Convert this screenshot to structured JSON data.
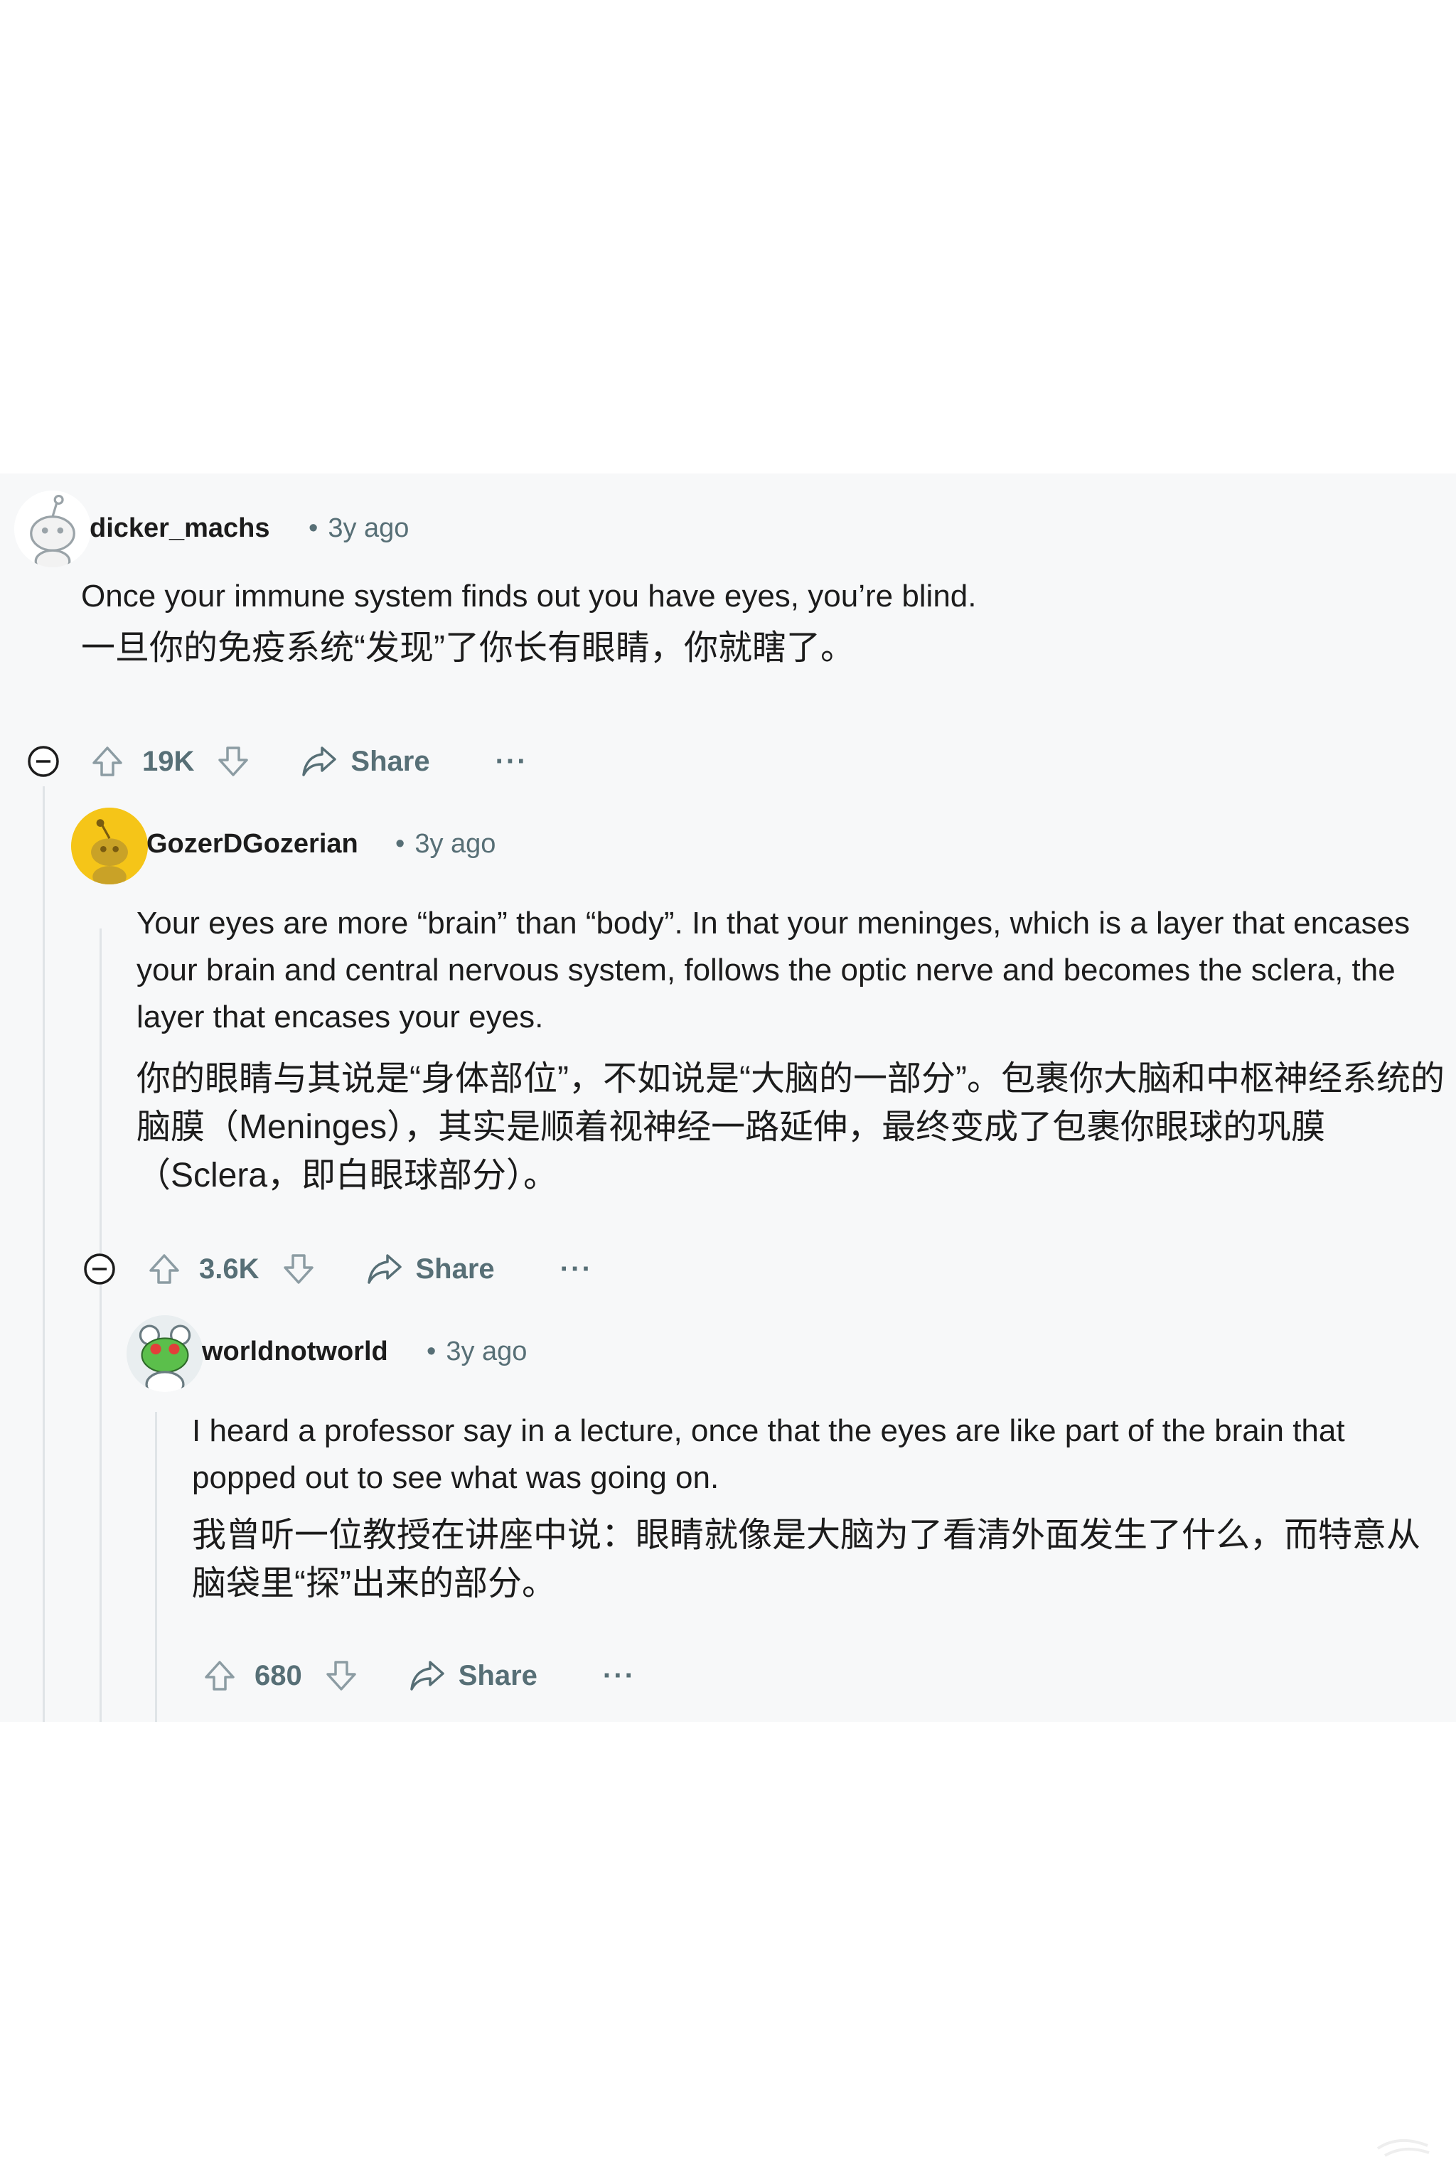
{
  "comments": [
    {
      "username": "dicker_machs",
      "age": "3y ago",
      "text_en": "Once your immune system finds out you have eyes, you’re blind.",
      "text_zh": "一旦你的免疫系统“发现”了你长有眼睛，你就瞎了。",
      "votes": "19K",
      "share_label": "Share",
      "more_label": "···"
    },
    {
      "username": "GozerDGozerian",
      "age": "3y ago",
      "text_en": "Your eyes are more “brain” than “body”. In that your meninges, which is a layer that encases your brain and central nervous system, follows the optic nerve and becomes the sclera, the layer that encases your eyes.",
      "text_zh": "你的眼睛与其说是“身体部位”，不如说是“大脑的一部分”。包裹你大脑和中枢神经系统的脑膜（Meninges），其实是顺着视神经一路延伸，最终变成了包裹你眼球的巩膜（Sclera，即白眼球部分）。",
      "votes": "3.6K",
      "share_label": "Share",
      "more_label": "···"
    },
    {
      "username": "worldnotworld",
      "age": "3y ago",
      "text_en": "I heard a professor say in a lecture, once that the eyes are like part of the brain that popped out to see what was going on.",
      "text_zh": "我曾听一位教授在讲座中说：眼睛就像是大脑为了看清外面发生了什么，而特意从脑袋里“探”出来的部分。",
      "votes": "680",
      "share_label": "Share",
      "more_label": "···"
    }
  ],
  "meta_separator": "•",
  "colors": {
    "panel_bg": "#f7f8f9",
    "meta_text": "#576f76",
    "thread_line": "#e0e4e7",
    "avatar_gozer_bg": "#f5c518"
  }
}
